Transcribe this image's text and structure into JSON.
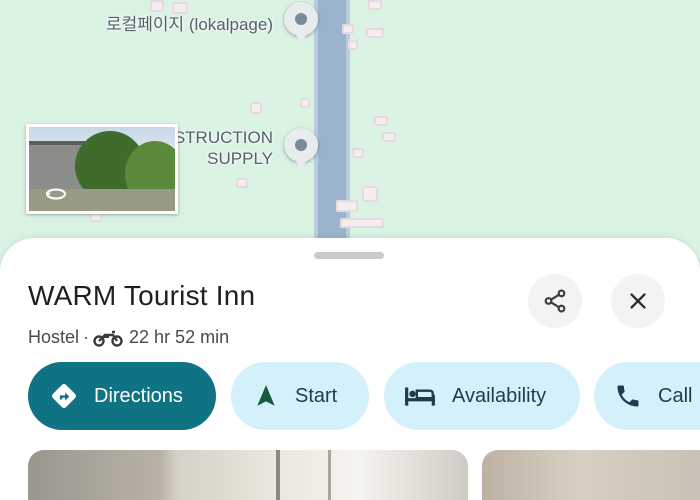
{
  "map": {
    "labels": [
      {
        "text": "로컬페이지 (lokalpage)"
      },
      {
        "lines": [
          "STRUCTION",
          "SUPPLY"
        ]
      }
    ],
    "icons": [
      "place-pin-icon",
      "place-pin-icon",
      "street-view-rotate-icon"
    ]
  },
  "place": {
    "name": "WARM Tourist Inn",
    "category": "Hostel",
    "separator": "·",
    "travel_mode_icon": "motorcycle-icon",
    "travel_time": "22 hr 52 min"
  },
  "header_buttons": {
    "share_icon": "share-icon",
    "close_icon": "close-icon"
  },
  "actions": [
    {
      "label": "Directions",
      "icon": "directions-icon",
      "primary": true
    },
    {
      "label": "Start",
      "icon": "navigation-arrow-icon"
    },
    {
      "label": "Availability",
      "icon": "bed-icon"
    },
    {
      "label": "Call",
      "icon": "phone-icon"
    }
  ],
  "colors": {
    "primary_action": "#0f7384",
    "chip_background": "#d4f0fb",
    "map_background": "#d9f2e2",
    "road": "#9bb3cc"
  }
}
